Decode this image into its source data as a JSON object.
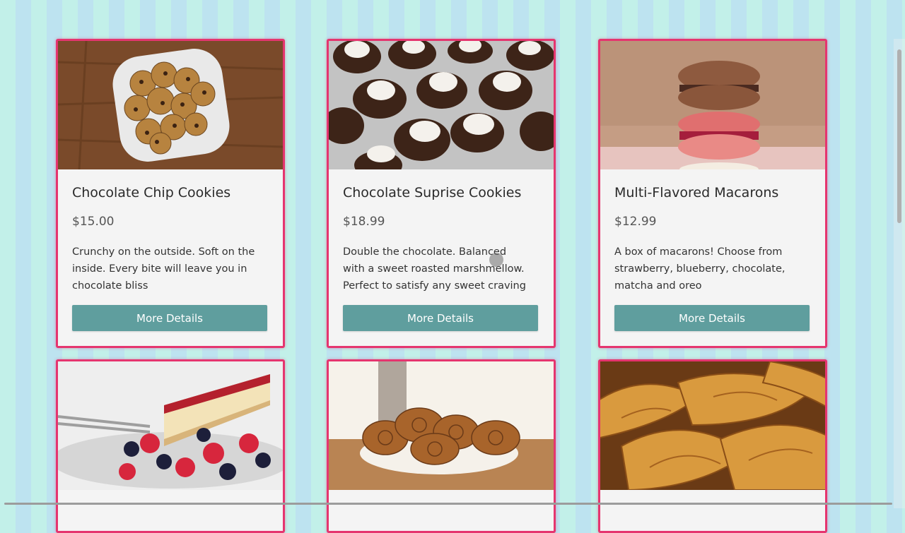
{
  "products": [
    {
      "title": "Chocolate Chip Cookies",
      "price": "$15.00",
      "description": "Crunchy on the outside. Soft on the inside. Every bite will leave you in chocolate bliss",
      "button_label": "More Details"
    },
    {
      "title": "Chocolate Suprise Cookies",
      "price": "$18.99",
      "description": "Double the chocolate. Balanced with a sweet roasted marshmellow. Perfect to satisfy any sweet craving",
      "button_label": "More Details"
    },
    {
      "title": "Multi-Flavored Macarons",
      "price": "$12.99",
      "description": "A box of macarons! Choose from strawberry, blueberry, chocolate, matcha and oreo",
      "button_label": "More Details"
    }
  ],
  "colors": {
    "card_border": "#e5356f",
    "button": "#5f9e9e",
    "stripe_a": "#c2f0e9",
    "stripe_b": "#bde3f0"
  }
}
